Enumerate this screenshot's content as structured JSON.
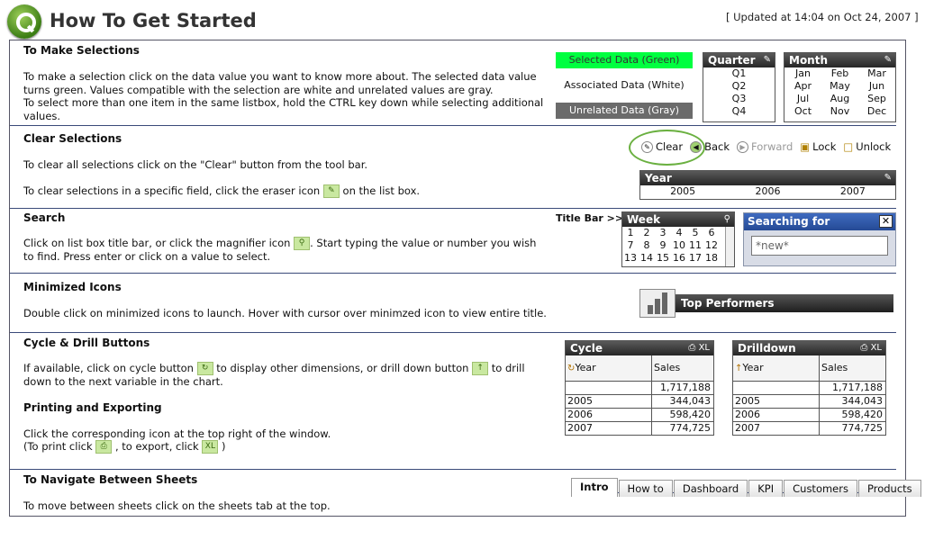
{
  "header": {
    "title": "How To Get Started",
    "updated": "[ Updated at 14:04 on Oct 24, 2007 ]"
  },
  "sections": {
    "selections": {
      "heading": "To Make Selections",
      "p1": "To make a selection click on the data value you want to know more about. The selected data value turns green. Values compatible with the selection are white and unrelated values are gray.",
      "p2": "To select more than one item in the same listbox, hold the CTRL key down while selecting additional values."
    },
    "clear": {
      "heading": "Clear Selections",
      "p1": "To clear all selections click on the \"Clear\" button from the tool bar.",
      "p2a": "To clear selections in a specific field, click the eraser icon",
      "p2b": "on the list box."
    },
    "search": {
      "heading": "Search",
      "p1a": "Click on list box title bar, or click the magnifier icon",
      "p1b": ". Start typing the value or number you wish to find. Press enter or click on a value to select."
    },
    "minimized": {
      "heading": "Minimized Icons",
      "p1": "Double click on minimized icons to launch. Hover with cursor over minimzed icon to view entire title."
    },
    "cycle": {
      "heading": "Cycle & Drill Buttons",
      "p1a": "If available, click on cycle button",
      "p1b": "to display other dimensions, or drill down button",
      "p1c": "to drill down to the next variable in the chart."
    },
    "printing": {
      "heading": "Printing and Exporting",
      "p1": "Click the corresponding icon at the top right of the window.",
      "p2a": "(To print click",
      "p2b": ", to export, click",
      "p2c": ")"
    },
    "navigate": {
      "heading": "To Navigate Between Sheets",
      "p1": "To move between sheets click on the sheets tab at the top."
    }
  },
  "legend": {
    "selected": "Selected Data (Green)",
    "associated": "Associated Data (White)",
    "unrelated": "Unrelated Data (Gray)",
    "colors": {
      "selected": "#00ff40",
      "unrelated": "#6b6b6b"
    }
  },
  "quarter": {
    "title": "Quarter",
    "values": [
      "Q1",
      "Q2",
      "Q3",
      "Q4"
    ]
  },
  "month": {
    "title": "Month",
    "values": [
      "Jan",
      "Feb",
      "Mar",
      "Apr",
      "May",
      "Jun",
      "Jul",
      "Aug",
      "Sep",
      "Oct",
      "Nov",
      "Dec"
    ]
  },
  "toolbar": {
    "clear": "Clear",
    "back": "Back",
    "forward": "Forward",
    "lock": "Lock",
    "unlock": "Unlock"
  },
  "year": {
    "title": "Year",
    "values": [
      "2005",
      "2006",
      "2007"
    ]
  },
  "titlebar_label": "Title Bar >>",
  "week": {
    "title": "Week",
    "values": [
      "1",
      "2",
      "3",
      "4",
      "5",
      "6",
      "7",
      "8",
      "9",
      "10",
      "11",
      "12",
      "13",
      "14",
      "15",
      "16",
      "17",
      "18"
    ]
  },
  "searchbox": {
    "title": "Searching for",
    "value": "*new*"
  },
  "minimized_icon": {
    "label": "Top Performers"
  },
  "cycle_table": {
    "title": "Cycle",
    "xl": "XL",
    "col1": "Year",
    "col2": "Sales",
    "total": "1,717,188",
    "rows": [
      [
        "2005",
        "344,043"
      ],
      [
        "2006",
        "598,420"
      ],
      [
        "2007",
        "774,725"
      ]
    ]
  },
  "drill_table": {
    "title": "Drilldown",
    "xl": "XL",
    "col1": "Year",
    "col2": "Sales",
    "total": "1,717,188",
    "rows": [
      [
        "2005",
        "344,043"
      ],
      [
        "2006",
        "598,420"
      ],
      [
        "2007",
        "774,725"
      ]
    ]
  },
  "print_icon": "Print",
  "xl_icon": "XL",
  "tabs": [
    "Intro",
    "How to",
    "Dashboard",
    "KPI",
    "Customers",
    "Products"
  ]
}
